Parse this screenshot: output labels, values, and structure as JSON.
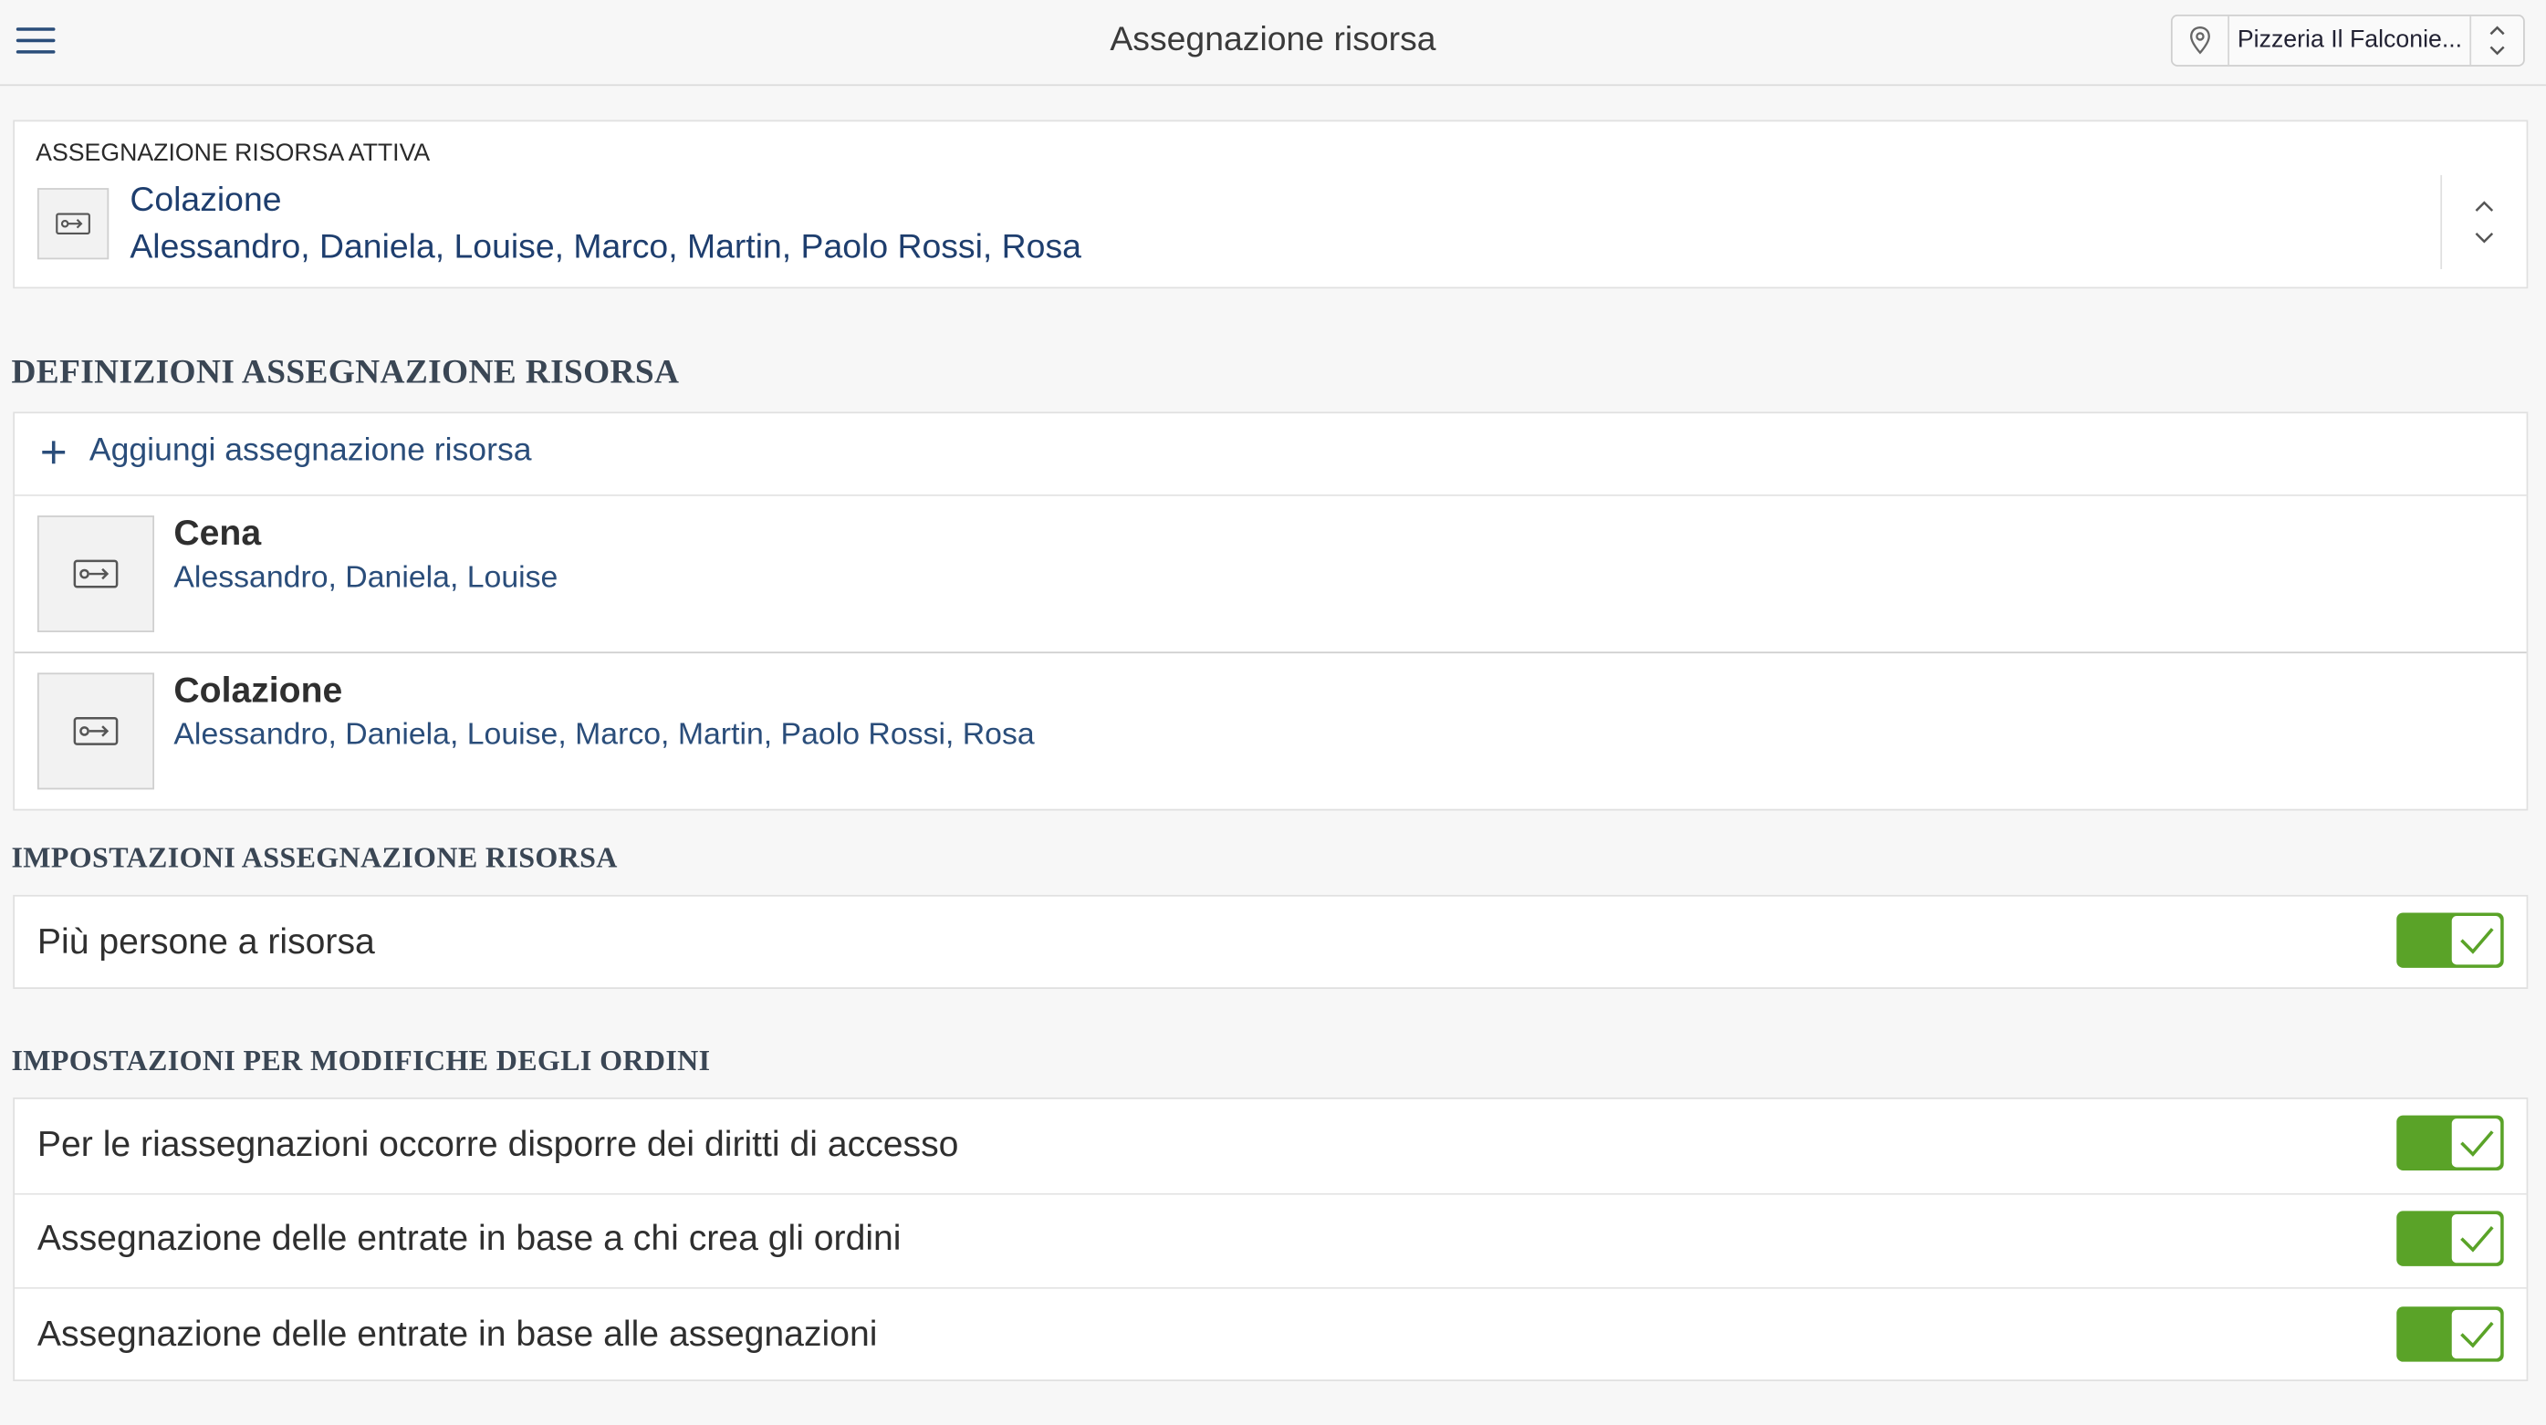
{
  "header": {
    "title": "Assegnazione risorsa",
    "location": "Pizzeria Il Falconie..."
  },
  "active": {
    "label": "ASSEGNAZIONE RISORSA ATTIVA",
    "name": "Colazione",
    "members": "Alessandro, Daniela, Louise, Marco, Martin, Paolo Rossi, Rosa"
  },
  "definitions": {
    "title": "DEFINIZIONI ASSEGNAZIONE RISORSA",
    "add_label": "Aggiungi assegnazione risorsa",
    "items": [
      {
        "name": "Cena",
        "members": "Alessandro, Daniela, Louise"
      },
      {
        "name": "Colazione",
        "members": "Alessandro, Daniela, Louise, Marco, Martin, Paolo Rossi, Rosa"
      }
    ]
  },
  "resource_settings": {
    "title": "IMPOSTAZIONI ASSEGNAZIONE RISORSA",
    "items": [
      {
        "label": "Più persone a risorsa",
        "enabled": true
      }
    ]
  },
  "order_settings": {
    "title": "IMPOSTAZIONI PER MODIFICHE DEGLI ORDINI",
    "items": [
      {
        "label": "Per le riassegnazioni occorre disporre dei diritti di accesso",
        "enabled": true
      },
      {
        "label": "Assegnazione delle entrate in base a chi crea gli ordini",
        "enabled": true
      },
      {
        "label": "Assegnazione delle entrate in base alle assegnazioni",
        "enabled": true
      }
    ]
  },
  "icons": {
    "menu": "hamburger-menu-icon",
    "location": "map-pin-icon",
    "sort": "chevron-up-down-icon",
    "resource": "key-arrow-icon",
    "add": "plus-icon",
    "check": "checkmark-icon"
  },
  "colors": {
    "accent_blue": "#2a4d7a",
    "toggle_on": "#5aa328"
  }
}
